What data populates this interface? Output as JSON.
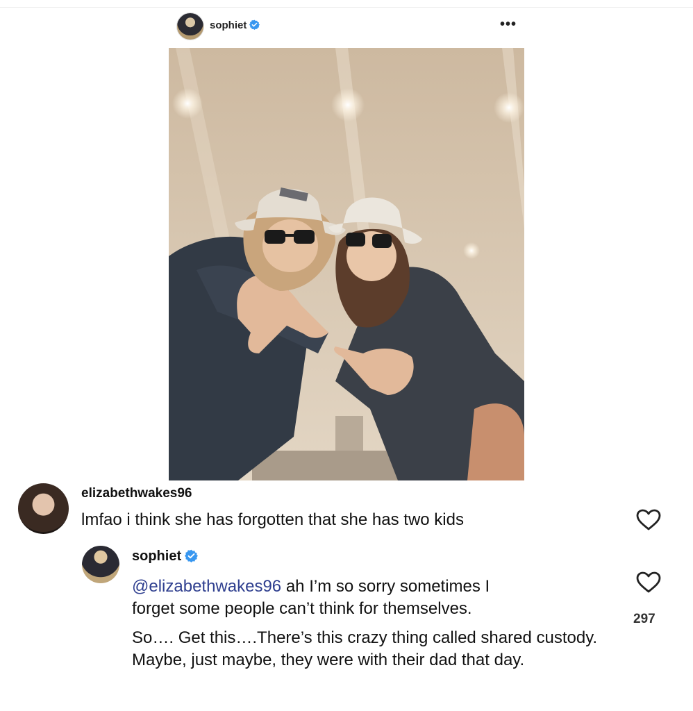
{
  "post": {
    "username": "sophiet",
    "more_label": "•••"
  },
  "comments": [
    {
      "username": "elizabethwakes96",
      "text": "lmfao i think she has forgotten that she has two kids"
    },
    {
      "username": "sophiet",
      "mention": "@elizabethwakes96",
      "line1_rest": " ah I’m so sorry sometimes I",
      "line2": "forget some people can’t think for themselves.",
      "paragraph2": "So…. Get this….There’s this crazy thing called shared custody. Maybe, just maybe, they were with their dad that day.",
      "like_count": "297"
    }
  ],
  "colors": {
    "verified_blue": "#3897f0",
    "mention": "#2f3f8f",
    "text": "#111111"
  },
  "icons": [
    "verified-badge-icon",
    "more-options-icon",
    "heart-icon"
  ]
}
